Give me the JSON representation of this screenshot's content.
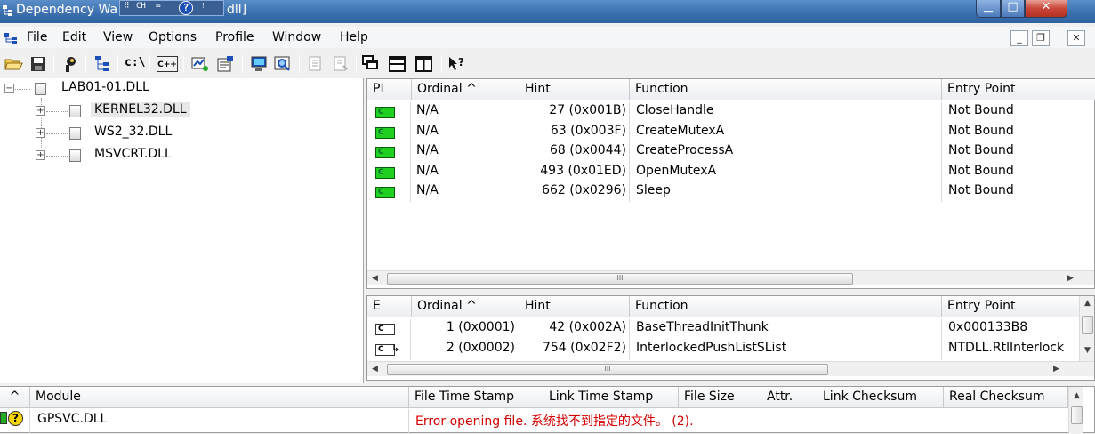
{
  "window": {
    "title": "Dependency Wa",
    "title_tail": "dll]",
    "ime": {
      "lang": "CH",
      "help": "?"
    }
  },
  "menu": {
    "items": [
      "File",
      "Edit",
      "View",
      "Options",
      "Profile",
      "Window",
      "Help"
    ]
  },
  "toolbar": {
    "icons": [
      "open-icon",
      "save-icon",
      "copy-icon",
      "full-paths-icon",
      "cpp-undecorate-icon",
      "view-full-paths-icon",
      "profile-icon",
      "properties-icon",
      "system-info-icon",
      "find-icon",
      "expand-icon",
      "collapse-icon",
      "cascade-icon",
      "tile-horizontal-icon",
      "tile-vertical-icon",
      "help-icon"
    ],
    "labels": {
      "cpath": "c:\\",
      "cpp": "C++"
    }
  },
  "tree": {
    "root": "LAB01-01.DLL",
    "children": [
      "KERNEL32.DLL",
      "WS2_32.DLL",
      "MSVCRT.DLL"
    ],
    "selected": "KERNEL32.DLL"
  },
  "imports": {
    "headers": [
      "PI",
      "Ordinal ^",
      "Hint",
      "Function",
      "Entry Point"
    ],
    "rows": [
      {
        "pi": "C",
        "ordinal": "N/A",
        "hint": "27 (0x001B)",
        "function": "CloseHandle",
        "entry": "Not Bound"
      },
      {
        "pi": "C",
        "ordinal": "N/A",
        "hint": "63 (0x003F)",
        "function": "CreateMutexA",
        "entry": "Not Bound"
      },
      {
        "pi": "C",
        "ordinal": "N/A",
        "hint": "68 (0x0044)",
        "function": "CreateProcessA",
        "entry": "Not Bound"
      },
      {
        "pi": "C",
        "ordinal": "N/A",
        "hint": "493 (0x01ED)",
        "function": "OpenMutexA",
        "entry": "Not Bound"
      },
      {
        "pi": "C",
        "ordinal": "N/A",
        "hint": "662 (0x0296)",
        "function": "Sleep",
        "entry": "Not Bound"
      }
    ],
    "scroll_thumb": "III"
  },
  "exports": {
    "headers": [
      "E",
      "Ordinal ^",
      "Hint",
      "Function",
      "Entry Point"
    ],
    "rows": [
      {
        "e": "C",
        "ordinal": "1 (0x0001)",
        "hint": "42 (0x002A)",
        "function": "BaseThreadInitThunk",
        "entry": "0x000133B8"
      },
      {
        "e": "C",
        "ordinal": "2 (0x0002)",
        "hint": "754 (0x02F2)",
        "function": "InterlockedPushListSList",
        "entry": "NTDLL.RtlInterlock"
      }
    ],
    "scroll_thumb": "III"
  },
  "modules": {
    "headers": [
      "^",
      "Module",
      "File Time Stamp",
      "Link Time Stamp",
      "File Size",
      "Attr.",
      "Link Checksum",
      "Real Checksum"
    ],
    "rows": [
      {
        "module": "GPSVC.DLL",
        "message": "Error opening file. 系统找不到指定的文件。 (2)."
      }
    ]
  },
  "colors": {
    "titlebar": "#3b6fae",
    "error_text": "#d40000",
    "import_icon": "#20d020"
  }
}
